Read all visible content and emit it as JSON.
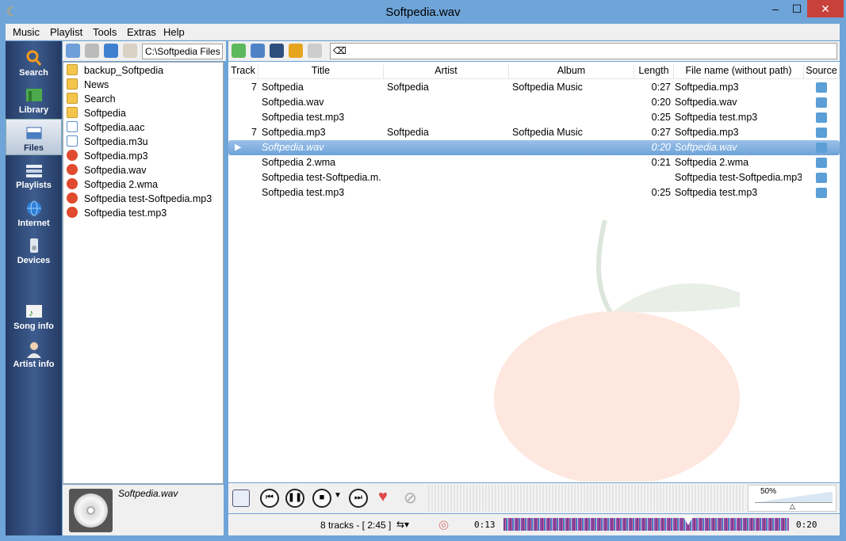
{
  "window": {
    "title": "Softpedia.wav",
    "min_glyph": "–",
    "max_glyph": "☐",
    "close_glyph": "✕"
  },
  "menu": [
    "Music",
    "Playlist",
    "Tools",
    "Extras",
    "Help"
  ],
  "sidebar": [
    {
      "label": "Search",
      "icon": "search-icon"
    },
    {
      "label": "Library",
      "icon": "library-icon"
    },
    {
      "label": "Files",
      "icon": "files-icon",
      "active": true
    },
    {
      "label": "Playlists",
      "icon": "playlists-icon"
    },
    {
      "label": "Internet",
      "icon": "globe-icon"
    },
    {
      "label": "Devices",
      "icon": "devices-icon"
    },
    {
      "label": "Song info",
      "icon": "song-info-icon"
    },
    {
      "label": "Artist info",
      "icon": "artist-info-icon"
    }
  ],
  "browser": {
    "path": "C:\\Softpedia Files",
    "items": [
      {
        "name": "backup_Softpedia",
        "type": "folder"
      },
      {
        "name": "News",
        "type": "folder"
      },
      {
        "name": "Search",
        "type": "folder"
      },
      {
        "name": "Softpedia",
        "type": "folder"
      },
      {
        "name": "Softpedia.aac",
        "type": "audio"
      },
      {
        "name": "Softpedia.m3u",
        "type": "audio"
      },
      {
        "name": "Softpedia.mp3",
        "type": "media"
      },
      {
        "name": "Softpedia.wav",
        "type": "media"
      },
      {
        "name": "Softpedia 2.wma",
        "type": "media"
      },
      {
        "name": "Softpedia test-Softpedia.mp3",
        "type": "media"
      },
      {
        "name": "Softpedia test.mp3",
        "type": "media"
      }
    ]
  },
  "cover": {
    "title": "Softpedia.wav"
  },
  "table": {
    "columns": [
      "Track",
      "Title",
      "Artist",
      "Album",
      "Length",
      "File name (without path)",
      "Source"
    ],
    "rows": [
      {
        "track": "7",
        "title": "Softpedia",
        "artist": "Softpedia",
        "album": "Softpedia Music",
        "length": "0:27",
        "file": "Softpedia.mp3"
      },
      {
        "track": "",
        "title": "Softpedia.wav",
        "artist": "",
        "album": "",
        "length": "0:20",
        "file": "Softpedia.wav"
      },
      {
        "track": "",
        "title": "Softpedia test.mp3",
        "artist": "",
        "album": "",
        "length": "0:25",
        "file": "Softpedia test.mp3"
      },
      {
        "track": "7",
        "title": "Softpedia.mp3",
        "artist": "Softpedia",
        "album": "Softpedia Music",
        "length": "0:27",
        "file": "Softpedia.mp3"
      },
      {
        "track": "",
        "title": "Softpedia.wav",
        "artist": "",
        "album": "",
        "length": "0:20",
        "file": "Softpedia.wav",
        "selected": true
      },
      {
        "track": "",
        "title": "Softpedia 2.wma",
        "artist": "",
        "album": "",
        "length": "0:21",
        "file": "Softpedia 2.wma"
      },
      {
        "track": "",
        "title": "Softpedia test-Softpedia.m...",
        "artist": "",
        "album": "",
        "length": "",
        "file": "Softpedia test-Softpedia.mp3"
      },
      {
        "track": "",
        "title": "Softpedia test.mp3",
        "artist": "",
        "album": "",
        "length": "0:25",
        "file": "Softpedia test.mp3"
      }
    ]
  },
  "player": {
    "volume": "50%",
    "track_count": "8 tracks - [ 2:45 ]",
    "elapsed": "0:13",
    "total": "0:20"
  }
}
